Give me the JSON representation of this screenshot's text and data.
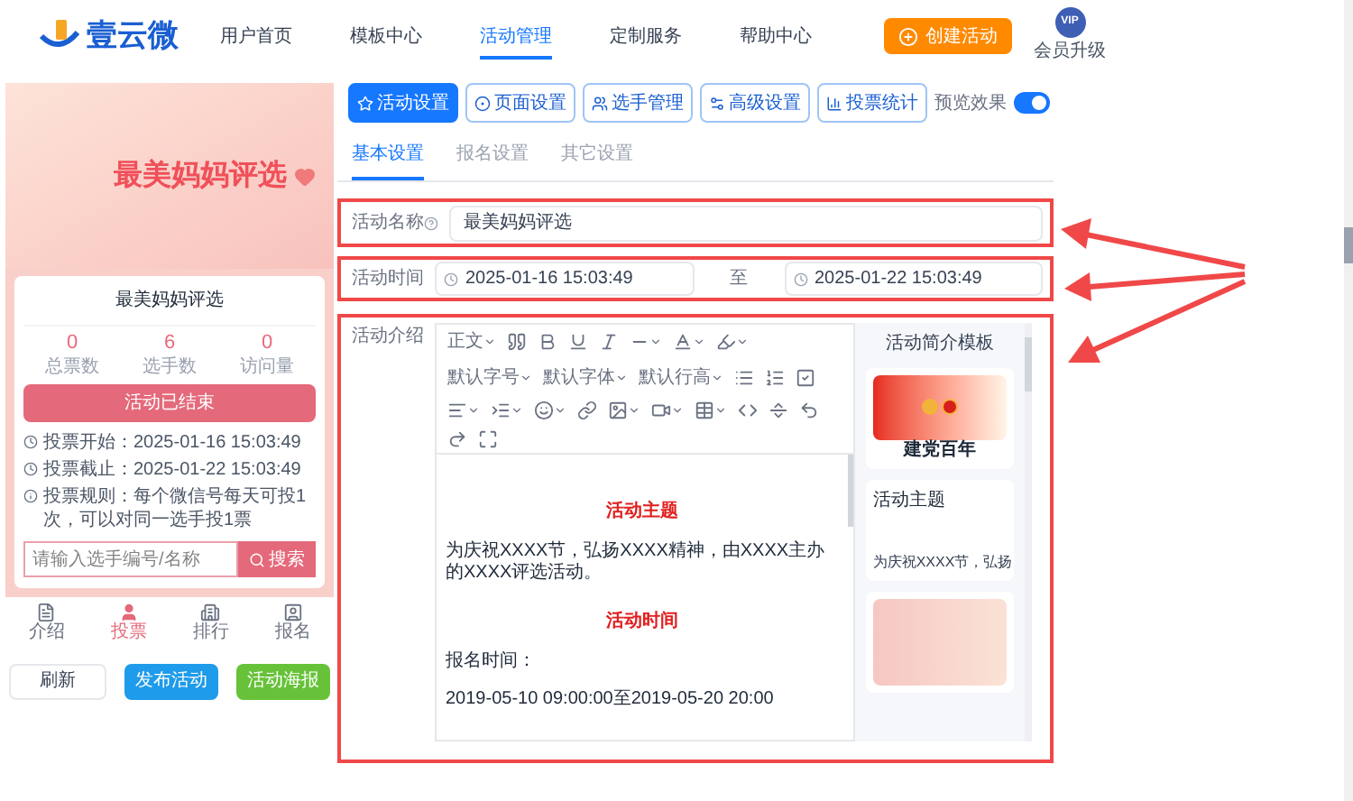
{
  "header": {
    "logo_text": "壹云微",
    "nav": [
      {
        "label": "用户首页",
        "selected": false
      },
      {
        "label": "模板中心",
        "selected": false
      },
      {
        "label": "活动管理",
        "selected": true
      },
      {
        "label": "定制服务",
        "selected": false
      },
      {
        "label": "帮助中心",
        "selected": false
      }
    ],
    "create_button": "创建活动",
    "vip": {
      "badge": "VIP",
      "label": "会员升级"
    }
  },
  "preview": {
    "banner_title": "最美妈妈评选",
    "title": "最美妈妈评选",
    "stats": [
      {
        "value": "0",
        "label": "总票数"
      },
      {
        "value": "6",
        "label": "选手数"
      },
      {
        "value": "0",
        "label": "访问量"
      }
    ],
    "status": "活动已结束",
    "info": [
      {
        "kind": "clock",
        "text": "投票开始：2025-01-16 15:03:49"
      },
      {
        "kind": "clock",
        "text": "投票截止：2025-01-22 15:03:49"
      },
      {
        "kind": "info",
        "text": "投票规则：每个微信号每天可投1次，可以对同一选手投1票"
      }
    ],
    "search": {
      "placeholder": "请输入选手编号/名称",
      "button": "搜索"
    },
    "bottom_nav": [
      {
        "label": "介绍",
        "selected": false
      },
      {
        "label": "投票",
        "selected": true
      },
      {
        "label": "排行",
        "selected": false
      },
      {
        "label": "报名",
        "selected": false
      }
    ]
  },
  "actions": [
    {
      "label": "刷新",
      "kind": "outline"
    },
    {
      "label": "发布活动",
      "kind": "primary"
    },
    {
      "label": "活动海报",
      "kind": "success"
    }
  ],
  "settings": {
    "toolbar": [
      {
        "label": "活动设置",
        "selected": true
      },
      {
        "label": "页面设置",
        "selected": false
      },
      {
        "label": "选手管理",
        "selected": false
      },
      {
        "label": "高级设置",
        "selected": false
      },
      {
        "label": "投票统计",
        "selected": false
      }
    ],
    "preview_toggle": {
      "label": "预览效果",
      "on": true
    },
    "tabs": [
      {
        "label": "基本设置",
        "selected": true
      },
      {
        "label": "报名设置",
        "selected": false
      },
      {
        "label": "其它设置",
        "selected": false
      }
    ],
    "form": {
      "name": {
        "label": "活动名称",
        "value": "最美妈妈评选"
      },
      "time": {
        "label": "活动时间",
        "start": "2025-01-16 15:03:49",
        "separator": "至",
        "end": "2025-01-22 15:03:49"
      },
      "intro": {
        "label": "活动介绍",
        "editor_toolbar": [
          "正文",
          "默认字号",
          "默认字体",
          "默认行高"
        ],
        "content": [
          {
            "kind": "heading",
            "text": "活动主题"
          },
          {
            "kind": "paragraph",
            "text": "为庆祝XXXX节，弘扬XXXX精神，由XXXX主办的XXXX评选活动。"
          },
          {
            "kind": "heading",
            "text": "活动时间"
          },
          {
            "kind": "paragraph",
            "text": "报名时间："
          },
          {
            "kind": "paragraph",
            "text": "2019-05-10 09:00:00至2019-05-20 20:00"
          }
        ],
        "templates": {
          "title": "活动简介模板",
          "items": [
            {
              "kind": "banner",
              "caption": "建党百年"
            },
            {
              "kind": "text",
              "heading": "活动主题",
              "text": "为庆祝XXXX节，弘扬"
            },
            {
              "kind": "image"
            }
          ]
        }
      }
    }
  }
}
